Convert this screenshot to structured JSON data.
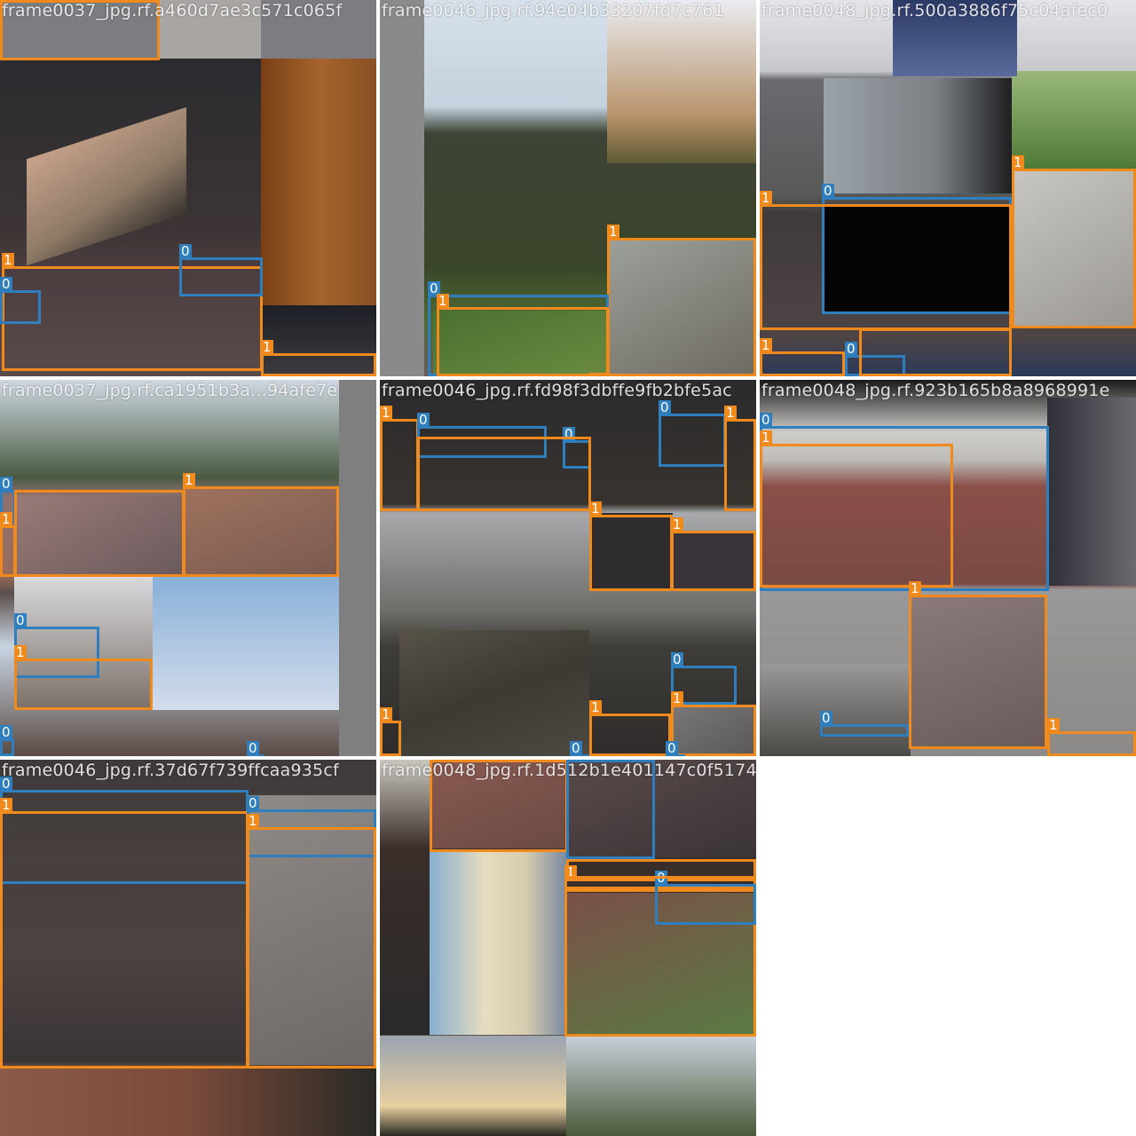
{
  "grid": {
    "tiles": [
      {
        "filename": "frame0037_jpg.rf.a460d7ae3c571c065f",
        "palette": [
          "#6e6e70",
          "#2a2a2c",
          "#8a4f22",
          "#4a3b3e",
          "#b0b5c0"
        ],
        "boxes": [
          {
            "cls": "1"
          },
          {
            "cls": "1"
          },
          {
            "cls": "0"
          },
          {
            "cls": "0"
          },
          {
            "cls": "1"
          }
        ]
      },
      {
        "filename": "frame0046_jpg.rf.94e04b33207fd7c761",
        "palette": [
          "#8a8a8a",
          "#c7d6e3",
          "#39452a",
          "#6b5a58",
          "#9ba08e"
        ],
        "boxes": [
          {
            "cls": "1"
          },
          {
            "cls": "0"
          },
          {
            "cls": "1"
          },
          {
            "cls": "1"
          }
        ]
      },
      {
        "filename": "frame0048_jpg.rf.500a3886f75c04afec0",
        "palette": [
          "#dfe1e8",
          "#3e4a6a",
          "#6a7060",
          "#514546",
          "#a8a6a2"
        ],
        "boxes": [
          {
            "cls": "1"
          },
          {
            "cls": "0"
          },
          {
            "cls": "1"
          },
          {
            "cls": "1"
          },
          {
            "cls": "0"
          },
          {
            "cls": "1"
          }
        ]
      },
      {
        "filename": "frame0037_jpg.rf.ca1951b3a...94afe7e",
        "palette": [
          "#3a4a3e",
          "#9a6c5a",
          "#7f7f7f",
          "#c9d4e2",
          "#5a4f4c"
        ],
        "boxes": [
          {
            "cls": "0"
          },
          {
            "cls": "1"
          },
          {
            "cls": "1"
          },
          {
            "cls": "1"
          },
          {
            "cls": "0"
          },
          {
            "cls": "1"
          },
          {
            "cls": "0"
          },
          {
            "cls": "0"
          }
        ]
      },
      {
        "filename": "frame0046_jpg.rf.fd98f3dbffe9fb2bfe5ac",
        "palette": [
          "#2b2829",
          "#6b6c6a",
          "#4c4a42",
          "#9c9ea0",
          "#35302e"
        ],
        "boxes": [
          {
            "cls": "1"
          },
          {
            "cls": "0"
          },
          {
            "cls": "0"
          },
          {
            "cls": "0"
          },
          {
            "cls": "1"
          },
          {
            "cls": "1"
          },
          {
            "cls": "1"
          },
          {
            "cls": "0"
          },
          {
            "cls": "1"
          },
          {
            "cls": "1"
          },
          {
            "cls": "1"
          },
          {
            "cls": "1"
          },
          {
            "cls": "0"
          },
          {
            "cls": "0"
          }
        ]
      },
      {
        "filename": "frame0048_jpg.rf.923b165b8a8968991e",
        "palette": [
          "#cfcdca",
          "#8a5048",
          "#5c5a5c",
          "#9a9898",
          "#2f3038"
        ],
        "boxes": [
          {
            "cls": "0"
          },
          {
            "cls": "1"
          },
          {
            "cls": "1"
          },
          {
            "cls": "0"
          },
          {
            "cls": "1"
          }
        ]
      },
      {
        "filename": "frame0046_jpg.rf.37d67f739ffcaa935cf",
        "palette": [
          "#403d40",
          "#7c7675",
          "#6a5a56",
          "#8a5a4a",
          "#3b3c32"
        ],
        "boxes": [
          {
            "cls": "0"
          },
          {
            "cls": "1"
          },
          {
            "cls": "0"
          },
          {
            "cls": "1"
          }
        ]
      },
      {
        "filename": "frame0048_jpg.rf.1d512b1e401147c0f517470",
        "palette": [
          "#b7b3aa",
          "#81504a",
          "#2a2c36",
          "#c9c0a8",
          "#5b6b4d"
        ],
        "boxes": [
          {
            "cls": "1"
          },
          {
            "cls": "1"
          },
          {
            "cls": "0"
          },
          {
            "cls": "1"
          },
          {
            "cls": "0"
          },
          {
            "cls": "1"
          }
        ]
      }
    ]
  },
  "colors": {
    "class0": "#2f7fbf",
    "class1": "#f08a1c",
    "background": "#ffffff"
  }
}
